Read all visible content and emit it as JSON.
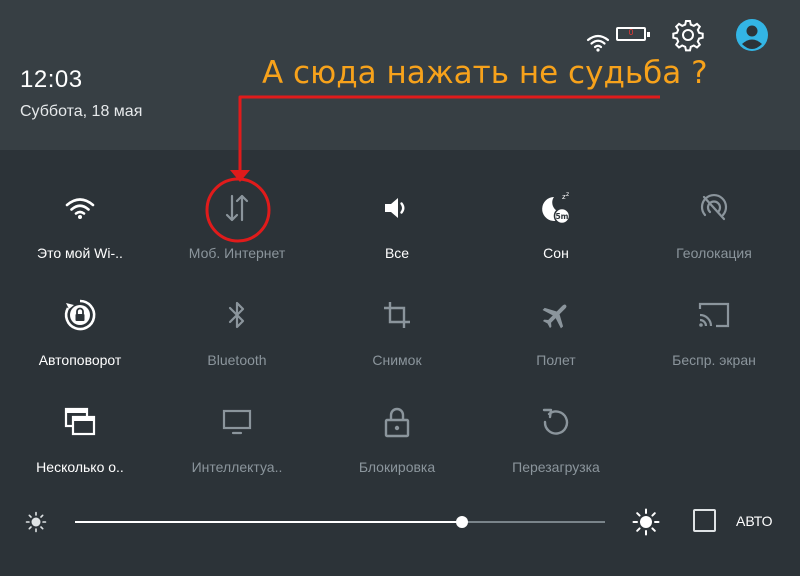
{
  "status_bar": {
    "time": "12:03",
    "date": "Суббота, 18 мая",
    "battery_level_text": "0",
    "icons": [
      "wifi-icon",
      "battery-icon",
      "gear-icon",
      "account-icon"
    ]
  },
  "annotation": {
    "text": "А сюда нажать не судьба ?",
    "color": "#f7a21b",
    "arrow_color": "#e01b1b"
  },
  "tiles": [
    {
      "label": "Это мой Wi-..",
      "icon": "wifi-icon",
      "active": true
    },
    {
      "label": "Моб. Интернет",
      "icon": "mobile-data-icon",
      "active": false
    },
    {
      "label": "Все",
      "icon": "volume-icon",
      "active": true
    },
    {
      "label": "Сон",
      "icon": "sleep-icon",
      "active": true
    },
    {
      "label": "Геолокация",
      "icon": "location-off-icon",
      "active": false
    },
    {
      "label": "Автоповорот",
      "icon": "auto-rotate-icon",
      "active": true
    },
    {
      "label": "Bluetooth",
      "icon": "bluetooth-icon",
      "active": false
    },
    {
      "label": "Снимок",
      "icon": "crop-icon",
      "active": false
    },
    {
      "label": "Полет",
      "icon": "airplane-icon",
      "active": false
    },
    {
      "label": "Беспр. экран",
      "icon": "cast-icon",
      "active": false
    },
    {
      "label": "Несколько о..",
      "icon": "multiwindow-icon",
      "active": true
    },
    {
      "label": "Интеллектуа..",
      "icon": "monitor-icon",
      "active": false
    },
    {
      "label": "Блокировка",
      "icon": "lock-icon",
      "active": false
    },
    {
      "label": "Перезагрузка",
      "icon": "restart-icon",
      "active": false
    }
  ],
  "brightness": {
    "level_fraction": 0.73,
    "auto_label": "АВТО",
    "auto_checked": false
  },
  "colors": {
    "panel_bg": "#2c3338",
    "header_bg": "#373f44",
    "active_text": "#ffffff",
    "inactive_text": "#8b959c",
    "avatar": "#33b5e5"
  }
}
